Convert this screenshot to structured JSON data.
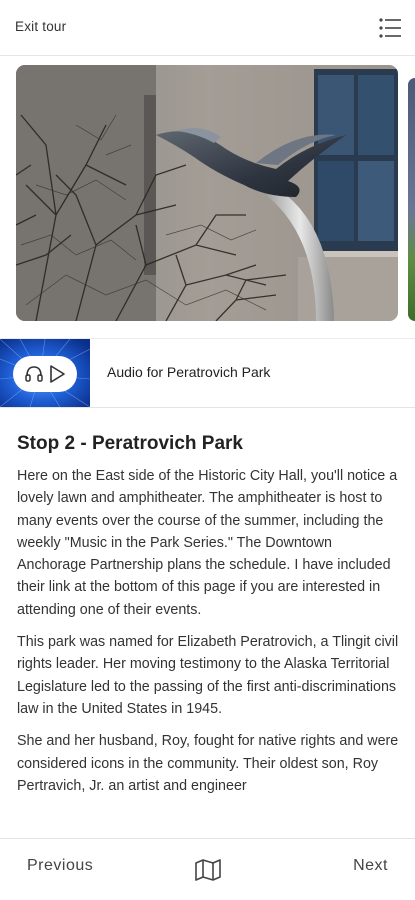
{
  "header": {
    "exit_label": "Exit tour",
    "menu_icon": "menu-list-icon"
  },
  "gallery": {
    "image_desc": "bird-sculpture-photo",
    "next_image_desc": "next-photo-peek"
  },
  "audio": {
    "label": "Audio for Peratrovich Park",
    "icons": [
      "headphones-icon",
      "play-icon"
    ]
  },
  "stop": {
    "title": "Stop 2 - Peratrovich Park",
    "paragraphs": [
      "Here on the East side of the Historic City Hall, you'll notice a lovely lawn and amphitheater. The amphitheater is host to many events over the course of the summer, including the weekly \"Music in the Park Series.\" The Downtown Anchorage Partnership plans the schedule. I have included their link at the bottom of this page if you are interested in attending one of their events.",
      "This park was named for Elizabeth Peratrovich, a Tlingit civil rights leader. Her moving testimony to the Alaska Territorial Legislature led to the passing of the first anti-discriminations law in the United States in 1945.",
      "She and her husband, Roy, fought for native rights and were considered icons in the community. Their oldest son, Roy Pertravich, Jr. an artist and engineer"
    ]
  },
  "footer": {
    "previous_label": "Previous",
    "next_label": "Next",
    "map_icon": "map-icon"
  },
  "colors": {
    "audio_blue": "#1f5fd6",
    "text": "#333333",
    "divider": "#e4e4e4"
  }
}
